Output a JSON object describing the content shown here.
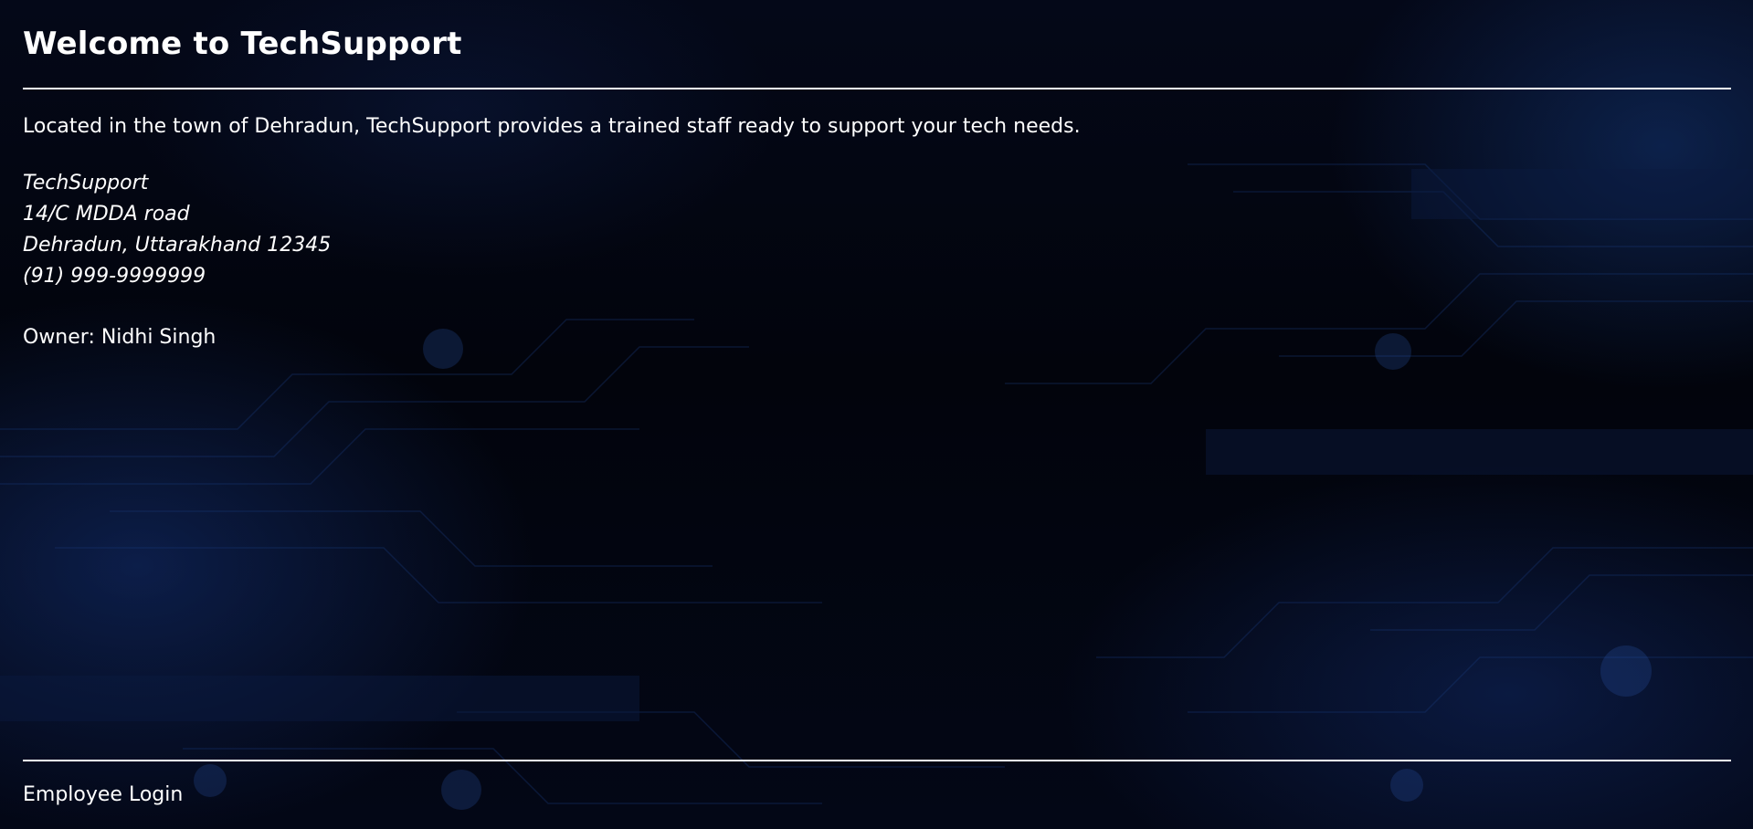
{
  "header": {
    "title": "Welcome to TechSupport"
  },
  "main": {
    "intro": "Located in the town of Dehradun, TechSupport provides a trained staff ready to support your tech needs.",
    "address": {
      "name": "TechSupport",
      "street": "14/C MDDA road",
      "city": "Dehradun, Uttarakhand 12345",
      "phone": "(91) 999-9999999"
    },
    "owner": "Owner: Nidhi Singh"
  },
  "footer": {
    "login_label": "Employee Login"
  },
  "colors": {
    "background": "#02040c",
    "text": "#ffffff",
    "circuit_accent": "#1b3a7a"
  }
}
